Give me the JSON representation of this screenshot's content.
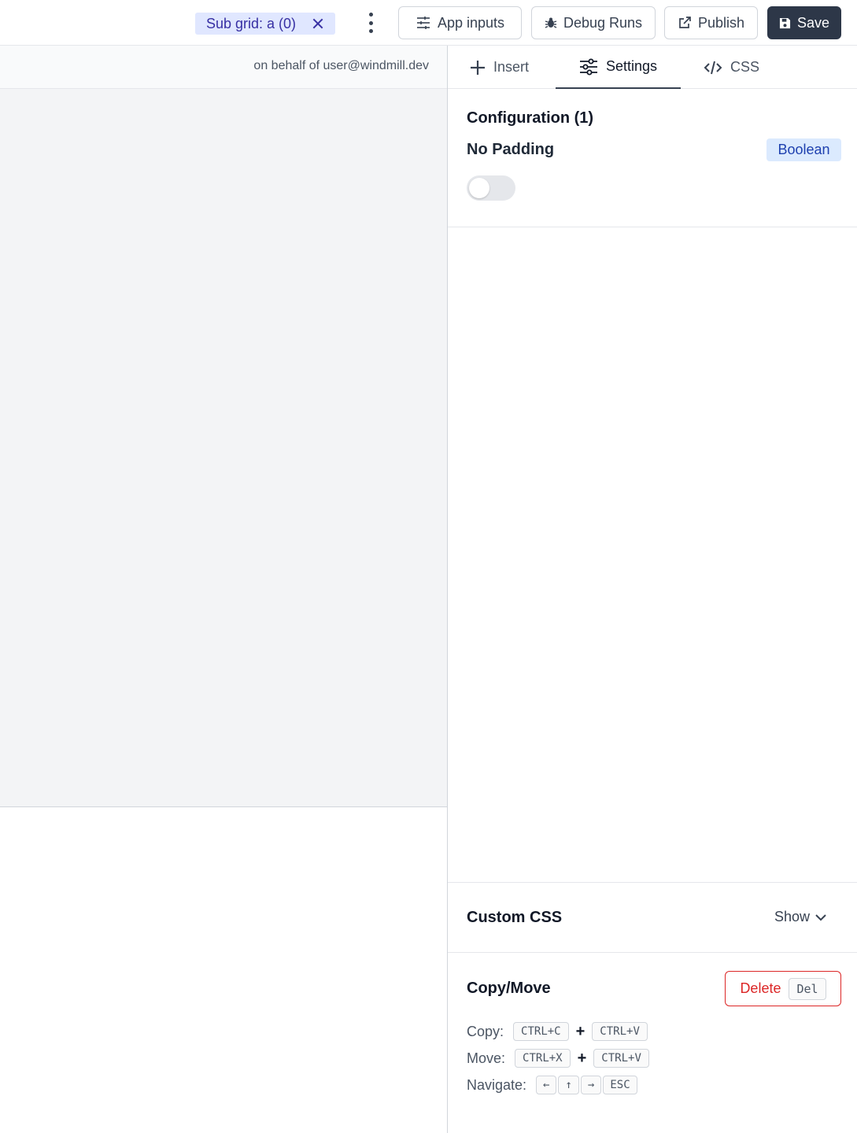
{
  "toolbar": {
    "subgrid_label": "Sub grid: a (0)",
    "app_inputs_label": "App inputs",
    "debug_runs_label": "Debug Runs",
    "publish_label": "Publish",
    "save_label": "Save"
  },
  "canvas": {
    "on_behalf": "on behalf of user@windmill.dev"
  },
  "tabs": {
    "insert": "Insert",
    "settings": "Settings",
    "css": "CSS",
    "active": "Settings"
  },
  "configuration": {
    "title": "Configuration (1)",
    "fields": [
      {
        "label": "No Padding",
        "type": "Boolean",
        "value": false
      }
    ]
  },
  "custom_css": {
    "title": "Custom CSS",
    "toggle_label": "Show"
  },
  "copy_move": {
    "title": "Copy/Move",
    "delete_label": "Delete",
    "delete_key": "Del",
    "copy_label": "Copy:",
    "copy_keys": [
      "CTRL+C",
      "CTRL+V"
    ],
    "move_label": "Move:",
    "move_keys": [
      "CTRL+X",
      "CTRL+V"
    ],
    "navigate_label": "Navigate:",
    "navigate_keys": [
      "←",
      "↑",
      "→",
      "ESC"
    ],
    "plus": "+"
  },
  "colors": {
    "accent_dark": "#2d3748",
    "subgrid_bg": "#e0e7ff",
    "subgrid_text": "#3730a3",
    "badge_bg": "#dbeafe",
    "badge_text": "#1e40af",
    "delete_red": "#dc2626"
  }
}
